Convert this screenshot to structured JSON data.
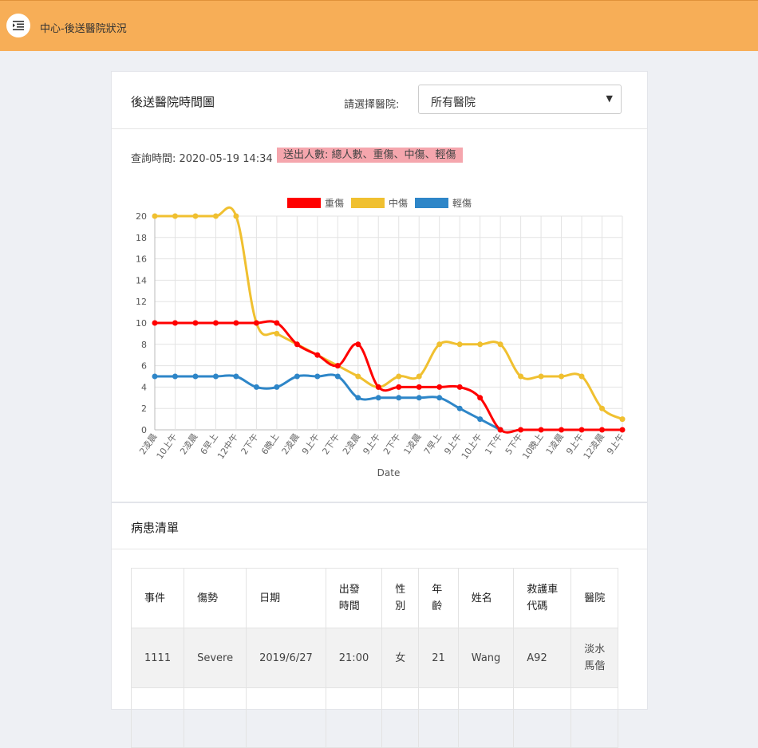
{
  "topbar": {
    "title": "中心-後送醫院狀況",
    "menu_icon": "menu-indent-icon",
    "background": "#f7ae57"
  },
  "chart_card": {
    "title": "後送醫院時間圖",
    "select_label": "請選擇醫院:",
    "select_value": "所有醫院",
    "query_time": "查詢時間: 2020-05-19 14:34",
    "badge": "送出人數: 總人數、重傷、中傷、輕傷",
    "badge_color": "#f5a6ad"
  },
  "chart_data": {
    "type": "line",
    "xlabel": "Date",
    "ylabel": "",
    "ylim": [
      0,
      20
    ],
    "yticks": [
      0,
      2,
      4,
      6,
      8,
      10,
      12,
      14,
      16,
      18,
      20
    ],
    "grid": true,
    "legend_position": "top",
    "categories": [
      "2凌晨",
      "10上午",
      "2凌晨",
      "6早上",
      "12中午",
      "2下午",
      "6晚上",
      "2凌晨",
      "9上午",
      "2下午",
      "2凌晨",
      "9上午",
      "2下午",
      "1凌晨",
      "7早上",
      "9上午",
      "10上午",
      "1下午",
      "5下午",
      "10晚上",
      "1凌晨",
      "9上午",
      "12凌晨",
      "9上午"
    ],
    "series": [
      {
        "name": "重傷",
        "color": "#ff0000",
        "values": [
          10,
          10,
          10,
          10,
          10,
          10,
          10,
          8,
          7,
          6,
          8,
          4,
          4,
          4,
          4,
          4,
          3,
          0,
          0,
          0,
          0,
          0,
          0,
          0
        ]
      },
      {
        "name": "中傷",
        "color": "#f0c030",
        "values": [
          20,
          20,
          20,
          20,
          20,
          10,
          9,
          8,
          7,
          6,
          5,
          4,
          5,
          5,
          8,
          8,
          8,
          8,
          5,
          5,
          5,
          5,
          2,
          1
        ]
      },
      {
        "name": "輕傷",
        "color": "#2e86c8",
        "values": [
          5,
          5,
          5,
          5,
          5,
          4,
          4,
          5,
          5,
          5,
          3,
          3,
          3,
          3,
          3,
          2,
          1,
          0,
          null,
          null,
          null,
          null,
          null,
          null
        ]
      }
    ]
  },
  "patients_card": {
    "title": "病患清單",
    "columns": [
      "事件",
      "傷勢",
      "日期",
      "出發\n時間",
      "性\n別",
      "年\n齡",
      "姓名",
      "救護車\n代碼",
      "醫院"
    ],
    "rows": [
      [
        "1111",
        "Severe",
        "2019/6/27",
        "21:00",
        "女",
        "21",
        "Wang",
        "A92",
        "淡水\n馬偕"
      ]
    ]
  }
}
